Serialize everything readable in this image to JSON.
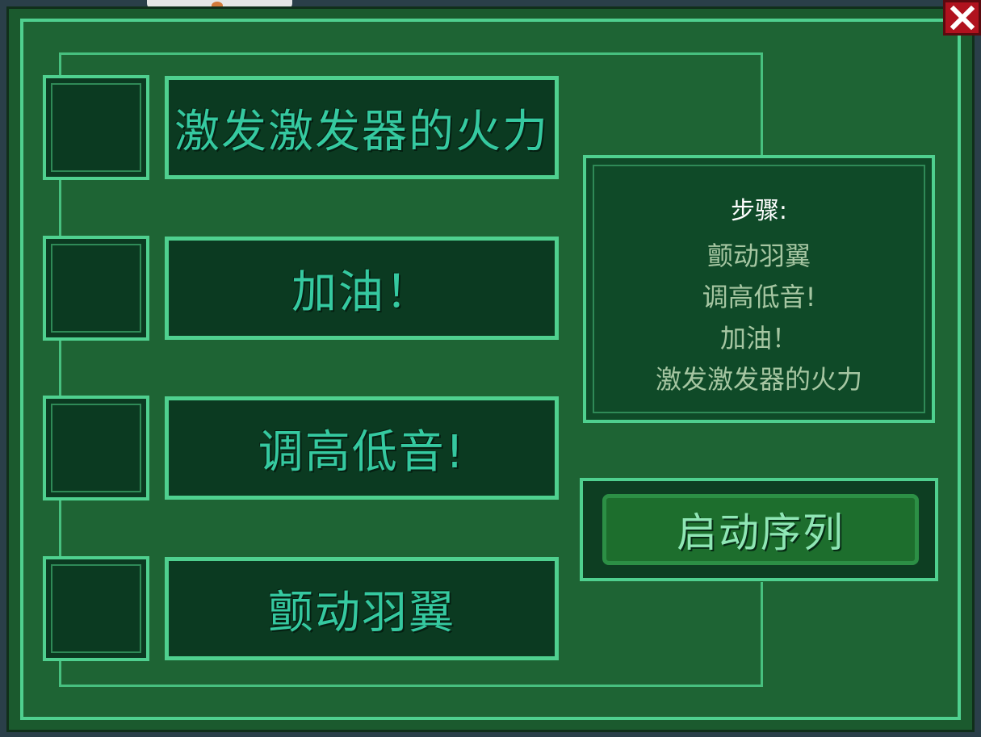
{
  "task": {
    "step_buttons": [
      {
        "label": "激发激发器的火力"
      },
      {
        "label": "加油！"
      },
      {
        "label": "调高低音!"
      },
      {
        "label": "颤动羽翼"
      }
    ],
    "instructions": {
      "title": "步骤:",
      "steps": [
        "颤动羽翼",
        "调高低音!",
        "加油！",
        "激发激发器的火力"
      ]
    },
    "start_button_label": "启动序列",
    "checkbox_states": [
      false,
      false,
      false,
      false
    ]
  },
  "colors": {
    "panel": "#1e6434",
    "accent": "#4fd08f",
    "button_text": "#35c9a0",
    "close": "#b0121e"
  },
  "icons": {
    "close": "close-x-icon"
  }
}
